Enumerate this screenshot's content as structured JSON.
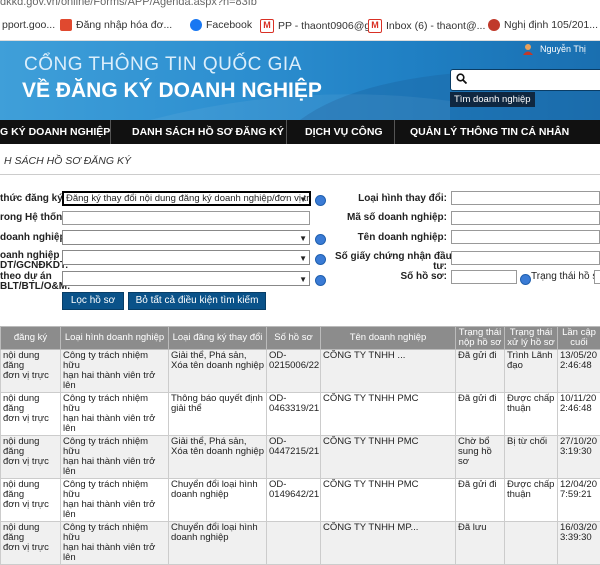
{
  "browser": {
    "url": "dkkd.gov.vn/online/Forms/APP/Agenda.aspx?h=83fb",
    "bookmarks": [
      {
        "label": "pport.goo...",
        "color": "#4285f4"
      },
      {
        "label": "Đăng nhập hóa đơ...",
        "color": "#e0492f"
      },
      {
        "label": "Facebook",
        "color": "#1877f2"
      },
      {
        "label": "PP - thaont0906@g...",
        "color": "#d93025"
      },
      {
        "label": "Inbox (6) - thaont@...",
        "color": "#d93025"
      },
      {
        "label": "Nghị định 105/201...",
        "color": "#c0392b"
      }
    ]
  },
  "header": {
    "line1": "CỔNG THÔNG TIN QUỐC GIA",
    "line2": "VỀ ĐĂNG KÝ DOANH NGHIỆP",
    "user_name": "Nguyễn Thị",
    "search_tooltip": "Tìm doanh nghiệp"
  },
  "nav": {
    "items": [
      "G KÝ DOANH NGHIỆP",
      "DANH SÁCH HỒ SƠ ĐĂNG KÝ",
      "DỊCH VỤ CÔNG",
      "QUẢN LÝ THÔNG TIN CÁ NHÂN"
    ]
  },
  "section_title": "H SÁCH HỒ SƠ ĐĂNG KÝ",
  "form": {
    "label_hinh_thuc": "thức đăng ký:",
    "select_hinh_thuc": "Đăng ký thay đổi nội dung đăng ký doanh nghiệp/đơn vị trự",
    "label_he_thong": "rong Hệ thống:",
    "label_doanh_nghiep": "doanh nghiệp:",
    "label_dn_co_line1": "oanh nghiệp có",
    "label_dn_co_line2": "DT/GCNĐKDT:",
    "label_du_an_line1": "theo dự án",
    "label_du_an_line2": "BLT/BTL/O&M:",
    "label_loai_hinh_thay_doi": "Loại hình thay đổi:",
    "label_ma_so": "Mã số doanh nghiệp:",
    "label_ten_dn": "Tên doanh nghiệp:",
    "label_giay_cn_line1": "Số giấy chứng nhận đầu",
    "label_giay_cn_line2": "tư:",
    "label_so_ho_so": "Số hồ sơ:",
    "label_trang_thai": "Trạng thái hồ sơ",
    "button_filter": "Lọc hồ sơ",
    "button_clear": "Bỏ tất cả điều kiện tìm kiếm"
  },
  "table": {
    "headers": [
      "đăng ký",
      "Loại hình doanh nghiệp",
      "Loại đăng ký thay đổi",
      "Số hồ sơ",
      "Tên doanh nghiệp",
      "Trạng thái nộp hồ sơ",
      "Trạng thái xử lý hồ sơ",
      "Lần cập cuối"
    ],
    "rows": [
      [
        "nội dung đăng\nđơn vị trực",
        "Công ty trách nhiệm hữu\nhạn hai thành viên trở lên",
        "Giải thể, Phá sản,\nXóa tên doanh nghiệp",
        "OD-\n0215006/22",
        "CÔNG TY TNHH ...",
        "Đã gửi đi",
        "Trình Lãnh\nđạo",
        "13/05/20\n2:46:48"
      ],
      [
        "nội dung đăng\nđơn vị trực",
        "Công ty trách nhiệm hữu\nhạn hai thành viên trở lên",
        "Thông báo quyết định\ngiải thể",
        "OD-\n0463319/21",
        "CÔNG TY TNHH PMC",
        "Đã gửi đi",
        "Được chấp\nthuận",
        "10/11/20\n2:46:48"
      ],
      [
        "nội dung đăng\nđơn vị trực",
        "Công ty trách nhiệm hữu\nhạn hai thành viên trở lên",
        "Giải thể, Phá sản,\nXóa tên doanh nghiệp",
        "OD-\n0447215/21",
        "CÔNG TY TNHH PMC",
        "Chờ bổ\nsung hồ sơ",
        "Bị từ chối",
        "27/10/20\n3:19:30"
      ],
      [
        "nội dung đăng\nđơn vị trực",
        "Công ty trách nhiệm hữu\nhạn hai thành viên trở lên",
        "Chuyển đổi loại hình\ndoanh nghiệp",
        "OD-\n0149642/21",
        "CÔNG TY TNHH PMC",
        "Đã gửi đi",
        "Được chấp\nthuận",
        "12/04/20\n7:59:21"
      ],
      [
        "nội dung đăng\nđơn vị trực",
        "Công ty trách nhiệm hữu\nhạn hai thành viên trở lên",
        "Chuyển đổi loại hình\ndoanh nghiệp",
        "",
        "CÔNG TY TNHH MP...",
        "Đã lưu",
        "",
        "16/03/20\n3:39:30"
      ]
    ]
  }
}
